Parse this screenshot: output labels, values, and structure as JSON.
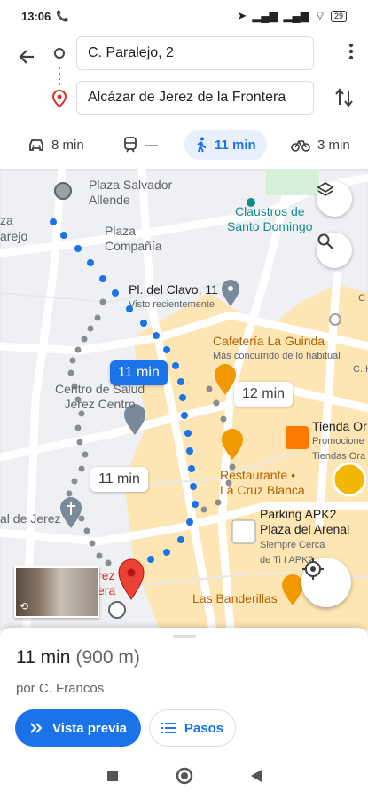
{
  "status_bar": {
    "time": "13:06",
    "battery": "29"
  },
  "route": {
    "origin": "C. Paralejo, 2",
    "destination": "Alcázar de Jerez de la Frontera"
  },
  "modes": [
    {
      "name": "car",
      "label": "8 min"
    },
    {
      "name": "transit",
      "label": "—"
    },
    {
      "name": "walk",
      "label": "11 min",
      "active": true
    },
    {
      "name": "bike",
      "label": "3 min"
    }
  ],
  "map": {
    "labels": {
      "plaza_salvador": "Plaza Salvador\nAllende",
      "plaza_compania": "Plaza\nCompañía",
      "za": "za",
      "arejo": "arejo",
      "claustros": "Claustros de\nSanto Domingo",
      "pl_clavo": "Pl. del Clavo, 11",
      "visto": "Visto recientemente",
      "cafeteria": "Cafetería La Guinda",
      "cafeteria_sub": "Más concurrido de lo habitual",
      "centro_salud": "Centro de Salud\nJerez Centro",
      "tienda": "Tienda Or",
      "tienda_sub": "Promocione\nTiendas Ora",
      "restaurante": "Restaurante •\nLa Cruz Blanca",
      "parking": "Parking APK2\nPlaza del Arenal",
      "parking_sub": "Siempre Cerca\nde Ti I APK2",
      "al_de_jerez": "al de Jerez",
      "banderillas": "Las Banderillas",
      "rez": "rez\nera",
      "c_h": "C. Hor",
      "c": "C"
    },
    "chips": {
      "selected": "11 min",
      "alt1": "12 min",
      "alt2": "11 min"
    },
    "colors": {
      "route": "#1a73e8",
      "area": "#fde6b4",
      "pin": "#ea4335"
    }
  },
  "sheet": {
    "time": "11 min",
    "distance": "(900 m)",
    "via": "por C. Francos",
    "preview_label": "Vista previa",
    "steps_label": "Pasos"
  }
}
